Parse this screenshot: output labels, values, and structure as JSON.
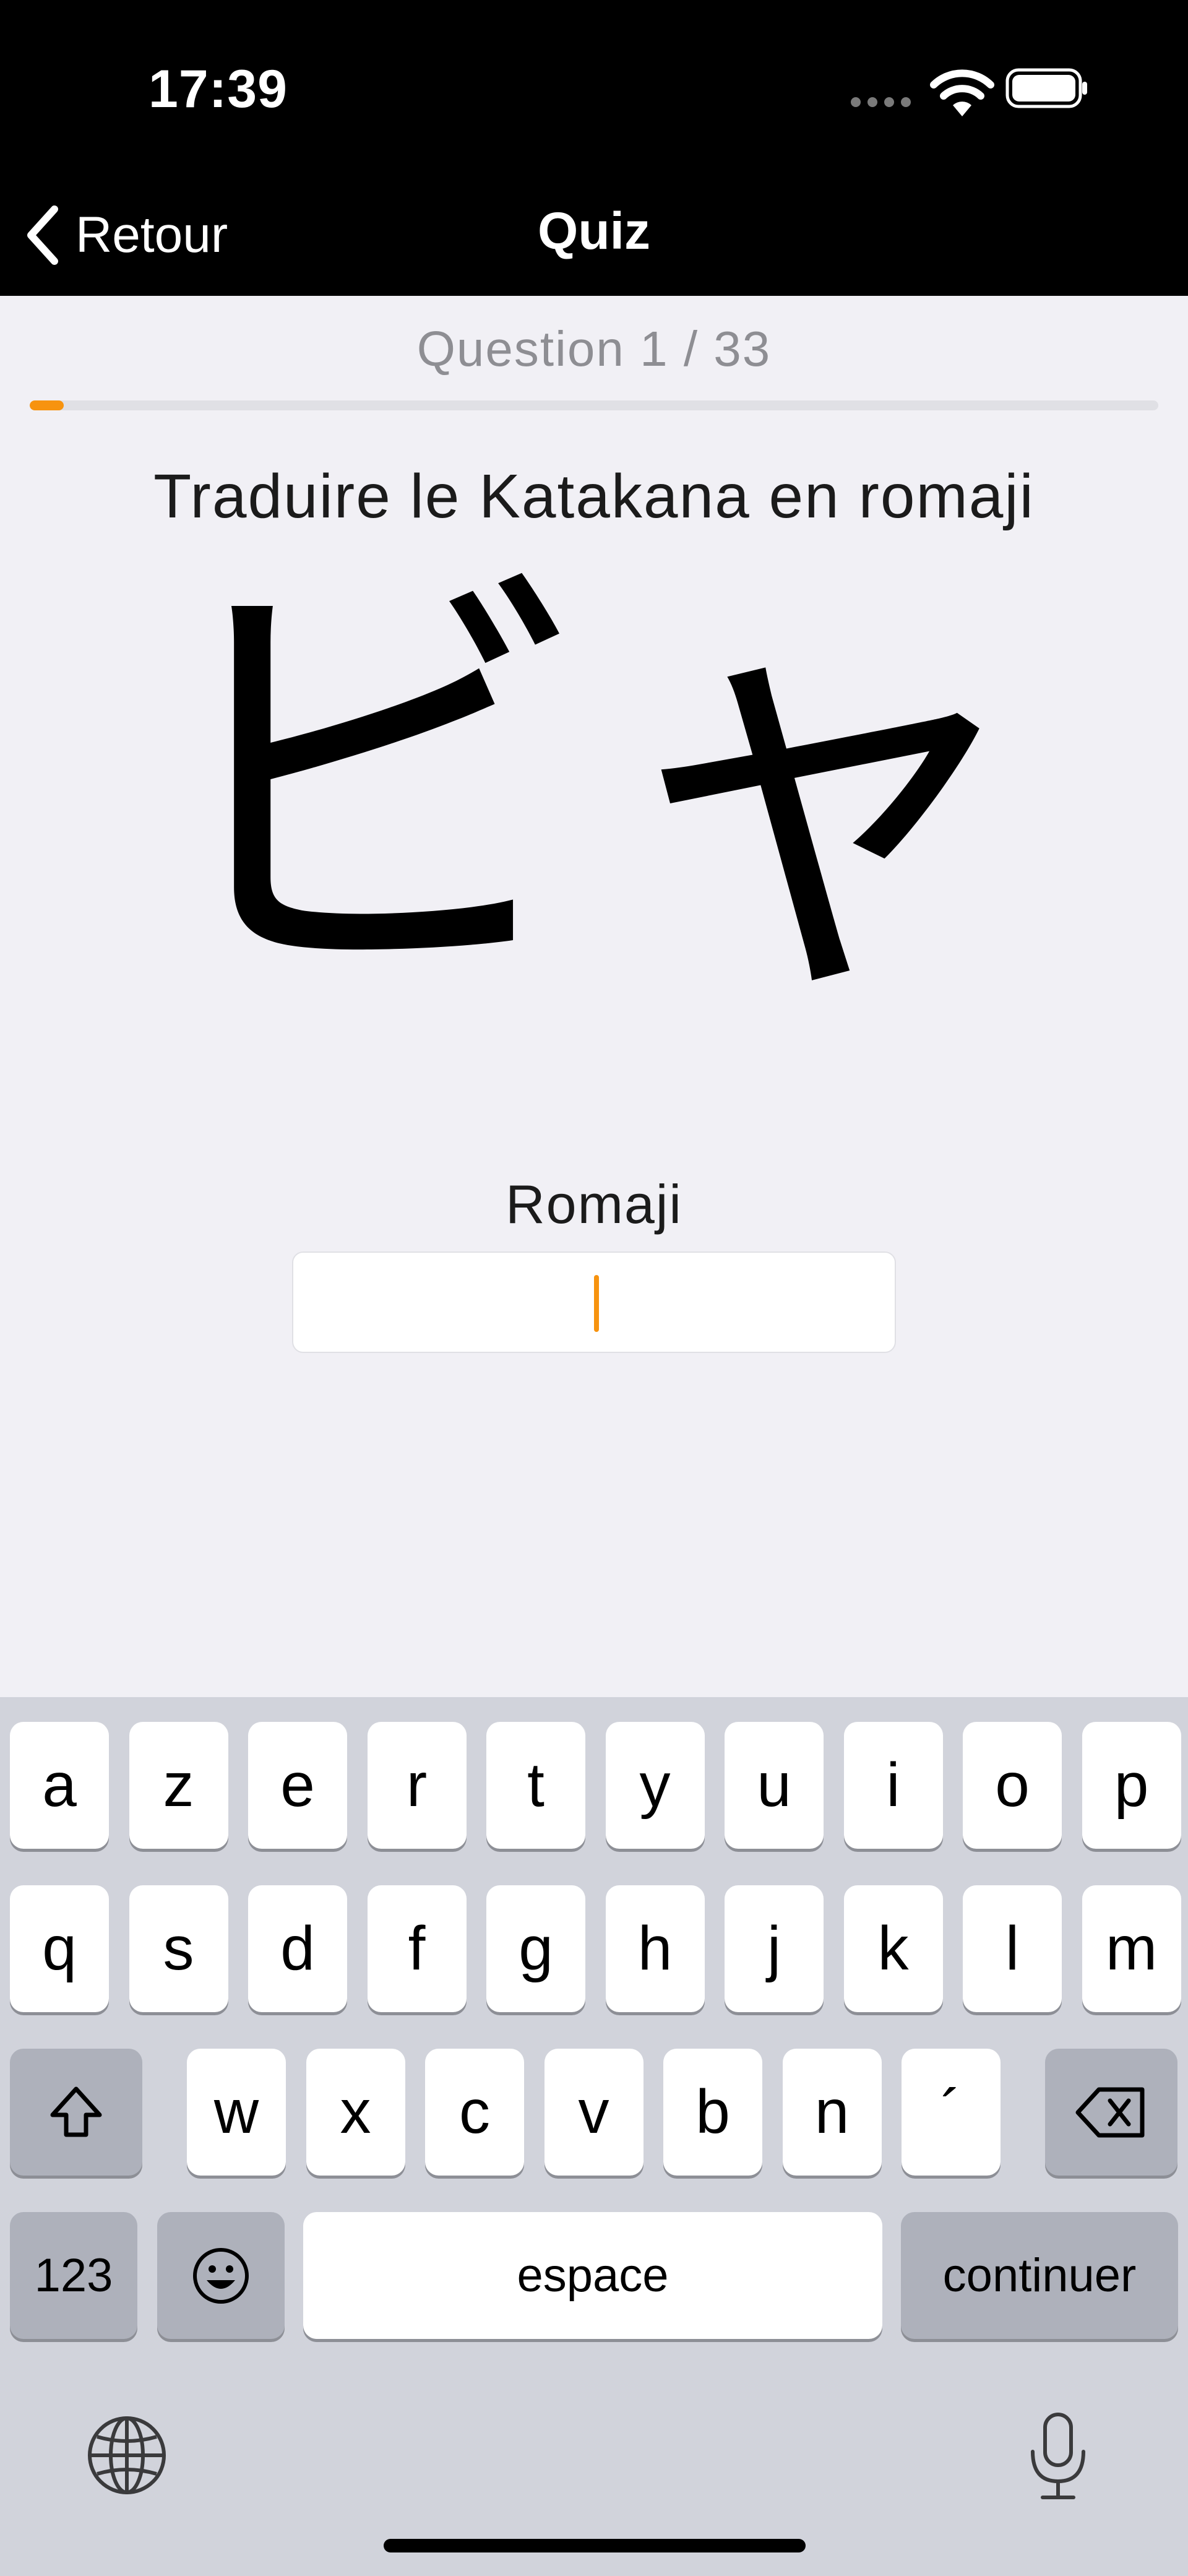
{
  "status_bar": {
    "time": "17:39"
  },
  "navbar": {
    "back_label": "Retour",
    "title": "Quiz"
  },
  "quiz": {
    "counter": "Question 1 / 33",
    "progress": 0.0303,
    "instruction": "Traduire le Katakana en romaji",
    "character": "ビャ",
    "field_label": "Romaji",
    "answer_value": ""
  },
  "keyboard": {
    "row1": [
      "a",
      "z",
      "e",
      "r",
      "t",
      "y",
      "u",
      "i",
      "o",
      "p"
    ],
    "row2": [
      "q",
      "s",
      "d",
      "f",
      "g",
      "h",
      "j",
      "k",
      "l",
      "m"
    ],
    "row3": [
      "w",
      "x",
      "c",
      "v",
      "b",
      "n",
      "´"
    ],
    "numbers_label": "123",
    "space_label": "espace",
    "return_label": "continuer"
  },
  "colors": {
    "accent": "#f7930f"
  }
}
